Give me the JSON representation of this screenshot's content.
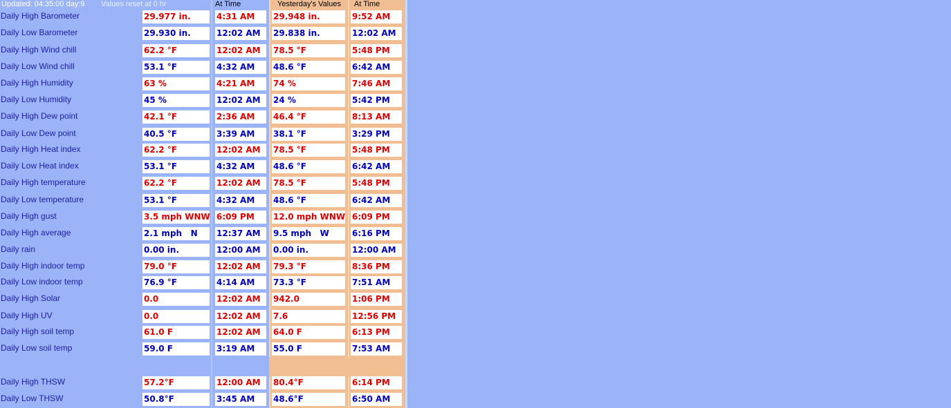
{
  "header": {
    "updated": "Updated: 04:35:00 day:9",
    "reset_note": "Values reset at 0 hr",
    "at_time_1": "At Time",
    "yesterday_values": "Yesterday's Values",
    "at_time_2": "At Time"
  },
  "colors": {
    "background_blue": "#9bb4f7",
    "yesterday_orange": "#f0be92",
    "high_value_red": "#dd0000",
    "low_value_blue": "#0000b8",
    "label_blue": "#1c1ca6"
  },
  "rows": [
    {
      "label": "Daily High Barometer",
      "today": "29.977 in.",
      "today_time": "4:31 AM",
      "yesterday": "29.948 in.",
      "yesterday_time": "9:52 AM",
      "tone": "red"
    },
    {
      "label": "Daily Low Barometer",
      "today": "29.930 in.",
      "today_time": "12:02 AM",
      "yesterday": "29.838 in.",
      "yesterday_time": "12:02 AM",
      "tone": "blue"
    },
    {
      "label": "Daily High Wind chill",
      "today": "62.2 °F",
      "today_time": "12:02 AM",
      "yesterday": "78.5 °F",
      "yesterday_time": "5:48 PM",
      "tone": "red"
    },
    {
      "label": "Daily Low Wind chill",
      "today": "53.1 °F",
      "today_time": "4:32 AM",
      "yesterday": "48.6 °F",
      "yesterday_time": "6:42 AM",
      "tone": "blue"
    },
    {
      "label": "Daily High Humidity",
      "today": "63 %",
      "today_time": "4:21 AM",
      "yesterday": "74 %",
      "yesterday_time": "7:46 AM",
      "tone": "red"
    },
    {
      "label": "Daily Low Humidity",
      "today": "45 %",
      "today_time": "12:02 AM",
      "yesterday": "24 %",
      "yesterday_time": "5:42 PM",
      "tone": "blue"
    },
    {
      "label": "Daily High Dew point",
      "today": "42.1 °F",
      "today_time": "2:36 AM",
      "yesterday": "46.4 °F",
      "yesterday_time": "8:13 AM",
      "tone": "red"
    },
    {
      "label": "Daily Low Dew point",
      "today": "40.5 °F",
      "today_time": "3:39 AM",
      "yesterday": "38.1 °F",
      "yesterday_time": "3:29 PM",
      "tone": "blue"
    },
    {
      "label": "Daily High Heat index",
      "today": "62.2 °F",
      "today_time": "12:02 AM",
      "yesterday": "78.5 °F",
      "yesterday_time": "5:48 PM",
      "tone": "red"
    },
    {
      "label": "Daily Low Heat index",
      "today": "53.1 °F",
      "today_time": "4:32 AM",
      "yesterday": "48.6 °F",
      "yesterday_time": "6:42 AM",
      "tone": "blue"
    },
    {
      "label": "Daily High temperature",
      "today": "62.2 °F",
      "today_time": "12:02 AM",
      "yesterday": "78.5 °F",
      "yesterday_time": "5:48 PM",
      "tone": "red"
    },
    {
      "label": "Daily Low temperature",
      "today": "53.1 °F",
      "today_time": "4:32 AM",
      "yesterday": "48.6 °F",
      "yesterday_time": "6:42 AM",
      "tone": "blue"
    },
    {
      "label": "Daily High gust",
      "today": "3.5 mph WNW",
      "today_time": "6:09 PM",
      "yesterday": "12.0 mph WNW",
      "yesterday_time": "6:09 PM",
      "tone": "red"
    },
    {
      "label": "Daily High average",
      "today": "2.1 mph   N",
      "today_time": "12:37 AM",
      "yesterday": "9.5 mph   W",
      "yesterday_time": "6:16 PM",
      "tone": "blue"
    },
    {
      "label": "Daily rain",
      "today": "0.00 in.",
      "today_time": "12:00 AM",
      "yesterday": "0.00 in.",
      "yesterday_time": "12:00 AM",
      "tone": "blue"
    },
    {
      "label": "Daily High indoor temp",
      "today": "79.0 °F",
      "today_time": "12:02 AM",
      "yesterday": "79.3 °F",
      "yesterday_time": "8:36 PM",
      "tone": "red"
    },
    {
      "label": "Daily Low indoor temp",
      "today": "76.9 °F",
      "today_time": "4:14 AM",
      "yesterday": "73.3 °F",
      "yesterday_time": "7:51 AM",
      "tone": "blue"
    },
    {
      "label": "Daily High Solar",
      "today": "0.0",
      "today_time": "12:02 AM",
      "yesterday": "942.0",
      "yesterday_time": "1:06 PM",
      "tone": "red"
    },
    {
      "label": "Daily High UV",
      "today": "0.0",
      "today_time": "12:02 AM",
      "yesterday": "7.6",
      "yesterday_time": "12:56 PM",
      "tone": "red"
    },
    {
      "label": "Daily High soil temp",
      "today": "61.0 F",
      "today_time": "12:02 AM",
      "yesterday": "64.0 F",
      "yesterday_time": "6:13 PM",
      "tone": "red"
    },
    {
      "label": "Daily Low soil temp",
      "today": "59.0 F",
      "today_time": "3:19 AM",
      "yesterday": "55.0 F",
      "yesterday_time": "7:53 AM",
      "tone": "blue"
    },
    {
      "label": "Daily High THSW",
      "today": "57.2°F",
      "today_time": "12:00 AM",
      "yesterday": "80.4°F",
      "yesterday_time": "6:14 PM",
      "tone": "red"
    },
    {
      "label": "Daily Low THSW",
      "today": "50.8°F",
      "today_time": "3:45 AM",
      "yesterday": "48.6°F",
      "yesterday_time": "6:50 AM",
      "tone": "blue"
    }
  ]
}
